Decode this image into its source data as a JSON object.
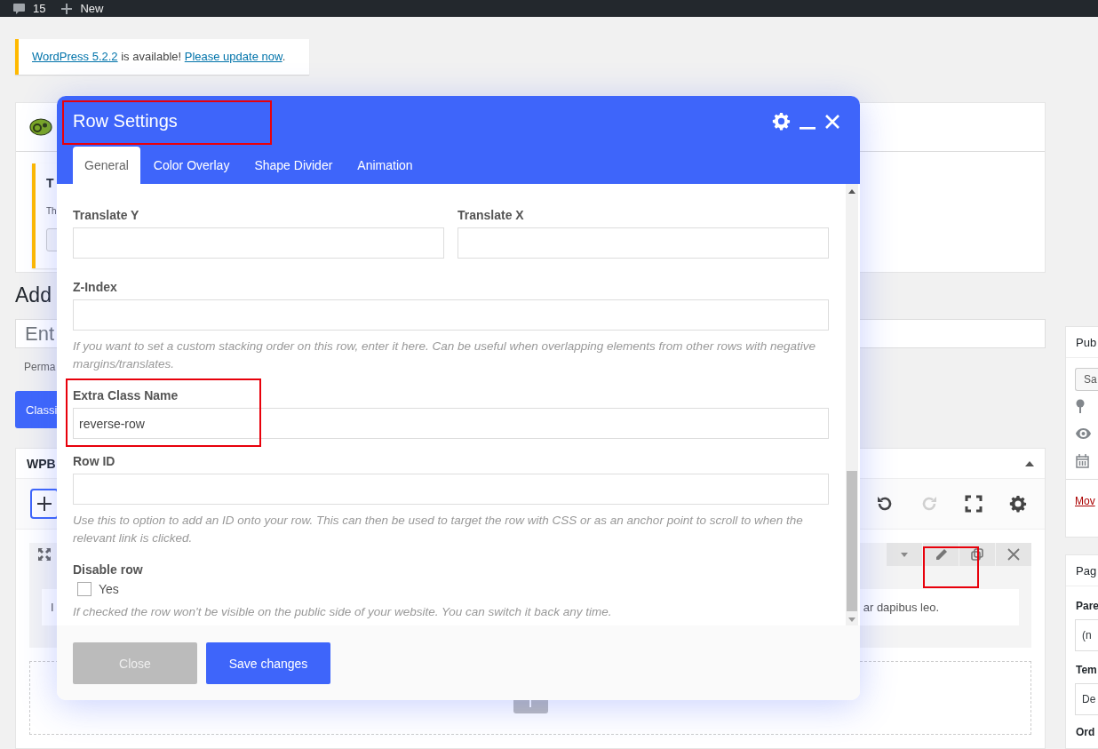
{
  "admin_bar": {
    "items": [
      {
        "kind": "comments",
        "label": "15"
      },
      {
        "kind": "new",
        "label": "New"
      }
    ]
  },
  "update_notice": {
    "parts": [
      {
        "kind": "link",
        "text": "WordPress 5.2.2"
      },
      {
        "kind": "text",
        "text": " is available! "
      },
      {
        "kind": "link",
        "text": "Please update now"
      },
      {
        "kind": "text",
        "text": "."
      }
    ]
  },
  "plugin_notice": {
    "heading": "T",
    "text": "Th"
  },
  "editor": {
    "heading": "Add",
    "title_placeholder": "Ent",
    "permalink_label": "Perma",
    "classic_button": "Classi"
  },
  "wpbakery": {
    "title": "WPB",
    "toolbar": [
      {
        "kind": "undo",
        "disabled": false
      },
      {
        "kind": "redo",
        "disabled": true
      },
      {
        "kind": "fullscreen",
        "disabled": false
      },
      {
        "kind": "settings",
        "disabled": false
      }
    ],
    "row_text_start": "I",
    "row_text_end": "ar dapibus leo."
  },
  "sidebar": {
    "publish": {
      "title": "Pub",
      "save_button": "Sa",
      "move_link": "Mov"
    },
    "page_attributes": {
      "title": "Pag",
      "parent_label": "Pare",
      "parent_value": "(n",
      "template_label": "Tem",
      "template_value": "De",
      "order_label": "Ord"
    }
  },
  "dialog": {
    "title": "Row Settings",
    "tabs": [
      {
        "label": "General",
        "selected": true
      },
      {
        "label": "Color Overlay",
        "selected": false
      },
      {
        "label": "Shape Divider",
        "selected": false
      },
      {
        "label": "Animation",
        "selected": false
      }
    ],
    "fields": [
      {
        "kind": "pair",
        "items": [
          {
            "label": "Translate Y"
          },
          {
            "label": "Translate X"
          }
        ]
      },
      {
        "kind": "text",
        "label": "Z-Index",
        "help": "If you want to set a custom stacking order on this row, enter it here. Can be useful when overlapping elements from other rows with negative margins/translates."
      },
      {
        "kind": "text",
        "label": "Extra Class Name",
        "value": "reverse-row"
      },
      {
        "kind": "text",
        "label": "Row ID",
        "help": "Use this to option to add an ID onto your row. This can then be used to target the row with CSS or as an anchor point to scroll to when the relevant link is clicked."
      },
      {
        "kind": "checkbox",
        "label": "Disable row",
        "option": "Yes",
        "checked": false,
        "help": "If checked the row won't be visible on the public side of your website. You can switch it back any time."
      }
    ],
    "buttons": {
      "close": "Close",
      "save": "Save changes"
    }
  }
}
